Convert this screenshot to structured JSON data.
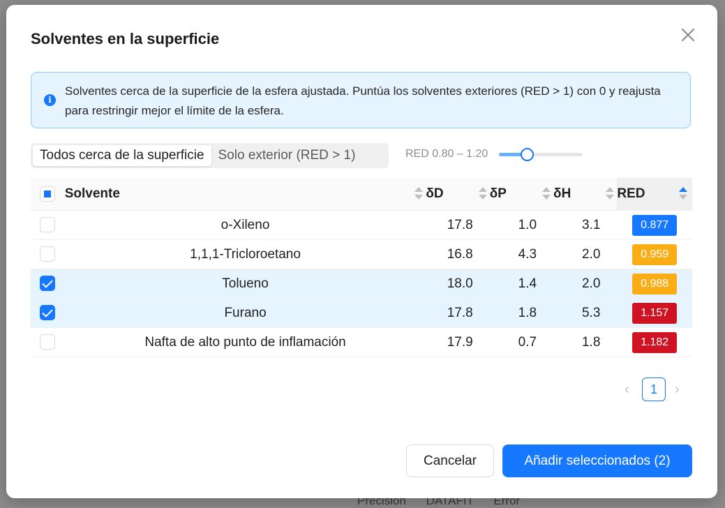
{
  "backdrop": {
    "text": "Precisión DATAFIT Error"
  },
  "dialog": {
    "title": "Solventes en la superficie",
    "info_text": "Solventes cerca de la superficie de la esfera ajustada. Puntúa los solventes exteriores (RED > 1) con 0 y reajusta para restringir mejor el límite de la esfera.",
    "info_icon": "info-icon",
    "close_icon": "close-icon"
  },
  "filter": {
    "options": [
      "Todos cerca de la superficie",
      "Solo exterior (RED > 1)"
    ],
    "selected_index": 0,
    "range_label": "RED 0.80 – 1.20",
    "slider_fraction": 0.33
  },
  "table": {
    "columns": [
      "Solvente",
      "δD",
      "δP",
      "δH",
      "RED"
    ],
    "sorted_column": "RED",
    "sort_direction": "ascending",
    "rows": [
      {
        "name": "o-Xileno",
        "dD": "17.8",
        "dP": "1.0",
        "dH": "3.1",
        "red": "0.877",
        "badge_color": "#1677ff",
        "checked": false
      },
      {
        "name": "1,1,1-Tricloroetano",
        "dD": "16.8",
        "dP": "4.3",
        "dH": "2.0",
        "red": "0.959",
        "badge_color": "#faad14",
        "checked": false
      },
      {
        "name": "Tolueno",
        "dD": "18.0",
        "dP": "1.4",
        "dH": "2.0",
        "red": "0.988",
        "badge_color": "#faad14",
        "checked": true
      },
      {
        "name": "Furano",
        "dD": "17.8",
        "dP": "1.8",
        "dH": "5.3",
        "red": "1.157",
        "badge_color": "#cf1322",
        "checked": true
      },
      {
        "name": "Nafta de alto punto de inflamación",
        "dD": "17.9",
        "dP": "0.7",
        "dH": "1.8",
        "red": "1.182",
        "badge_color": "#cf1322",
        "checked": false
      }
    ]
  },
  "pagination": {
    "current": "1",
    "prev_icon": "chevron-left-icon",
    "next_icon": "chevron-right-icon"
  },
  "footer": {
    "cancel_label": "Cancelar",
    "submit_label": "Añadir seleccionados (2)"
  }
}
